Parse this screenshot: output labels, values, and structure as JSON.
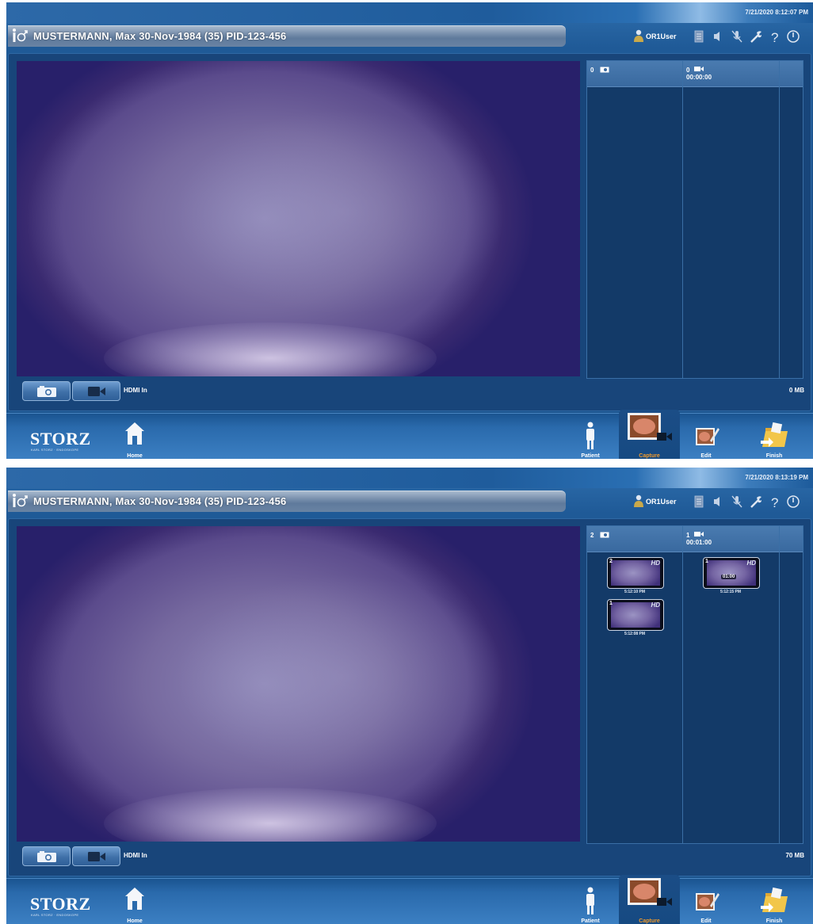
{
  "screens": [
    {
      "datetime": "7/21/2020  8:12:07 PM",
      "patient": "MUSTERMANN, Max  30-Nov-1984 (35)  PID-123-456",
      "user": "OR1User",
      "image_count": "0",
      "video_count": "0",
      "video_duration": "00:00:00",
      "source": "HDMI In",
      "storage": "0 MB",
      "image_thumbs": [],
      "video_thumbs": []
    },
    {
      "datetime": "7/21/2020  8:13:19 PM",
      "patient": "MUSTERMANN, Max  30-Nov-1984 (35)  PID-123-456",
      "user": "OR1User",
      "image_count": "2",
      "video_count": "1",
      "video_duration": "00:01:00",
      "source": "HDMI In",
      "storage": "70 MB",
      "image_thumbs": [
        {
          "num": "2",
          "label": "HD",
          "time": "5:12:10 PM"
        },
        {
          "num": "1",
          "label": "HD",
          "time": "5:12:08 PM"
        }
      ],
      "video_thumbs": [
        {
          "num": "1",
          "label": "HD",
          "duration": "01:00",
          "time": "5:12:15 PM"
        }
      ]
    }
  ],
  "nav": {
    "logo": "STORZ",
    "logo_sub": "KARL STORZ · ENDOSKOPE",
    "home": "Home",
    "patient": "Patient",
    "capture": "Capture",
    "edit": "Edit",
    "finish": "Finish"
  },
  "colors": {
    "accent_active": "#f29a2b",
    "panel_bg": "#18457a",
    "header_bg": "#1f5c9c"
  },
  "icons": {
    "patient_gender": "patient-male-icon",
    "user": "user-icon",
    "toolbar": [
      "document-icon",
      "volume-icon",
      "mic-muted-icon",
      "wrench-icon",
      "help-icon",
      "power-icon"
    ],
    "capture_photo": "camera-icon",
    "capture_video": "video-camera-icon"
  }
}
